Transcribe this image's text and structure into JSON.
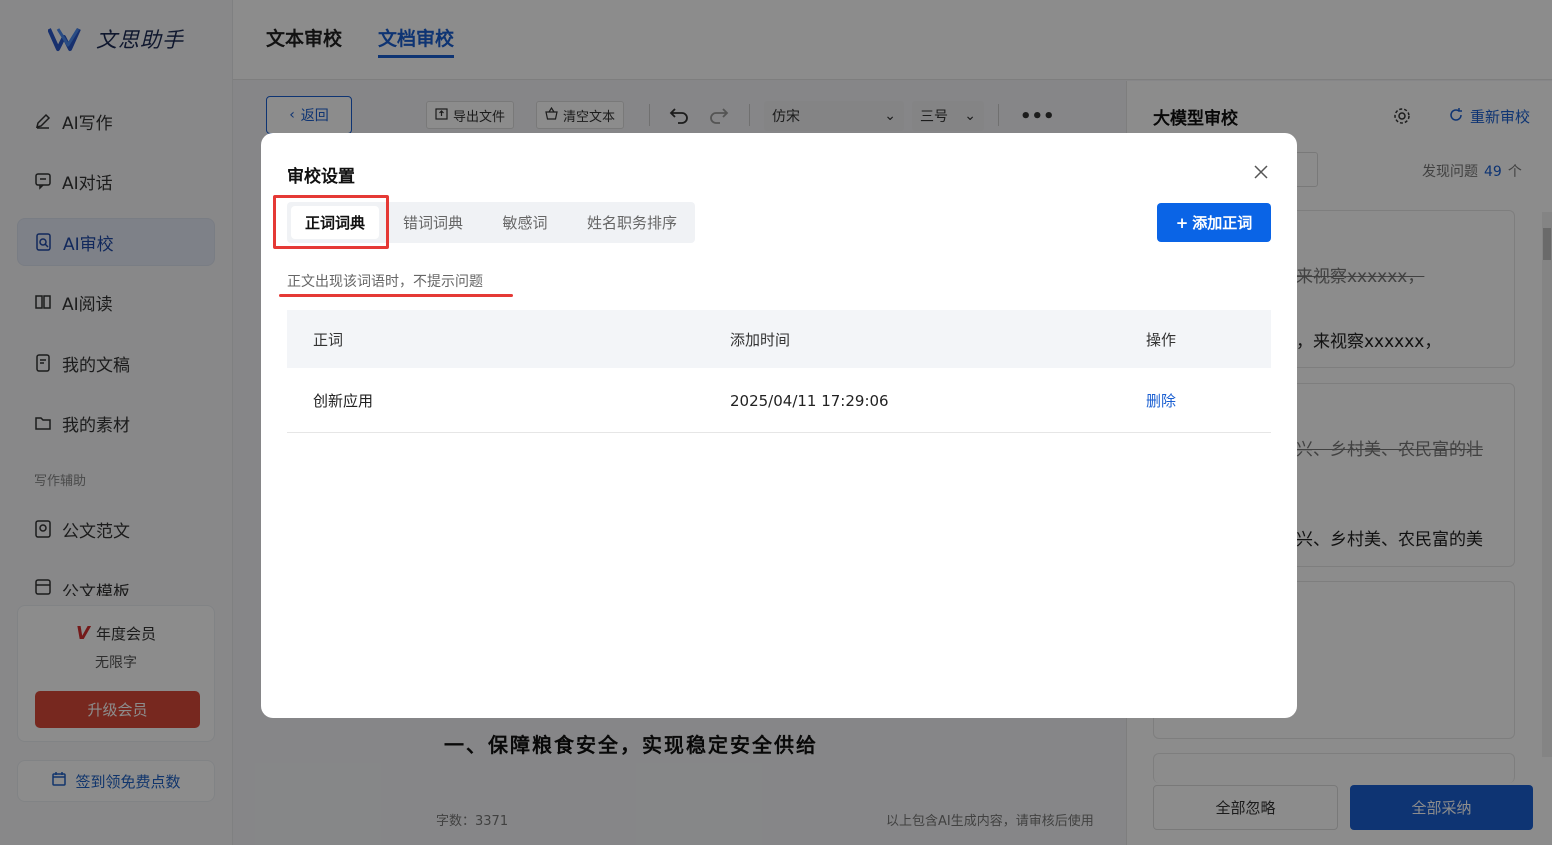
{
  "app": {
    "name": "文思助手"
  },
  "sidebar": {
    "items": [
      {
        "label": "AI写作",
        "icon": "pen-icon"
      },
      {
        "label": "AI对话",
        "icon": "chat-icon"
      },
      {
        "label": "AI审校",
        "icon": "doc-search-icon",
        "active": true
      },
      {
        "label": "AI阅读",
        "icon": "book-icon"
      },
      {
        "label": "我的文稿",
        "icon": "file-icon"
      },
      {
        "label": "我的素材",
        "icon": "folder-icon"
      }
    ],
    "section_label": "写作辅助",
    "sub_items": [
      {
        "label": "公文范文",
        "icon": "template-icon"
      },
      {
        "label": "公文模板",
        "icon": "layout-icon"
      }
    ],
    "member": {
      "title": "年度会员",
      "subtitle": "无限字",
      "upgrade_label": "升级会员"
    },
    "signin_label": "签到领免费点数"
  },
  "top_tabs": [
    {
      "label": "文本审校",
      "active": false
    },
    {
      "label": "文档审校",
      "active": true
    }
  ],
  "toolbar": {
    "back_label": "返回",
    "export_label": "导出文件",
    "clear_label": "清空文本",
    "font_value": "仿宋",
    "size_value": "三号"
  },
  "editor": {
    "heading": "一、保障粮食安全，实现稳定安全供给",
    "word_count": "字数：3371",
    "ai_note": "以上包含AI生成内容，请审核后使用"
  },
  "right_panel": {
    "title": "大模型审校",
    "recheck_label": "重新审校",
    "found_prefix": "发现问题",
    "found_count": "49",
    "found_suffix": "个",
    "snippets": [
      {
        "text": "来视察xxxxxx，",
        "deleted": true
      },
      {
        "text": "，来视察xxxxxx，",
        "deleted": false
      },
      {
        "text": "兴、乡村美、农民富的壮",
        "deleted": true
      },
      {
        "text": "兴、乡村美、农民富的美",
        "deleted": false
      }
    ],
    "ignore_all_label": "全部忽略",
    "accept_all_label": "全部采纳"
  },
  "modal": {
    "title": "审校设置",
    "tabs": [
      {
        "label": "正词词典",
        "active": true
      },
      {
        "label": "错词词典",
        "active": false
      },
      {
        "label": "敏感词",
        "active": false
      },
      {
        "label": "姓名职务排序",
        "active": false
      }
    ],
    "add_button_label": "添加正词",
    "hint": "正文出现该词语时，不提示问题",
    "table": {
      "headers": [
        "正词",
        "添加时间",
        "操作"
      ],
      "rows": [
        {
          "word": "创新应用",
          "time": "2025/04/11 17:29:06",
          "action": "删除"
        }
      ]
    }
  },
  "colors": {
    "accent": "#1a5fd1",
    "primary_button": "#0a64e6",
    "annotation_red": "#e53935",
    "upgrade_red": "#d94a3a"
  }
}
